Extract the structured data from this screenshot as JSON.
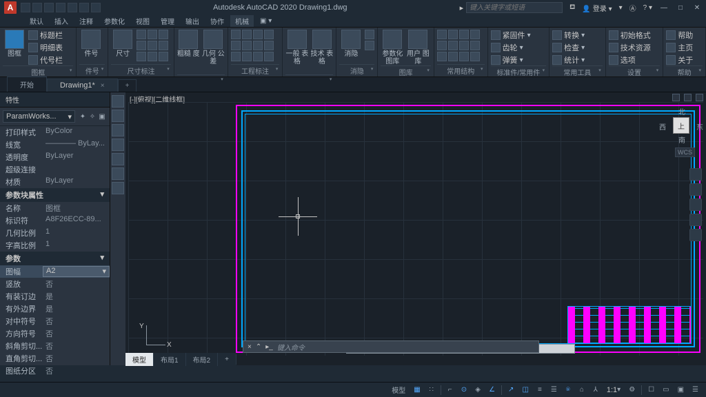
{
  "app_icon_letter": "A",
  "title": "Autodesk AutoCAD 2020   Drawing1.dwg",
  "search_placeholder": "键入关键字或短语",
  "login_label": "登录",
  "menus": [
    "默认",
    "插入",
    "注释",
    "参数化",
    "视图",
    "管理",
    "输出",
    "协作",
    "机械"
  ],
  "ribbon": {
    "panel1": {
      "label": "图框",
      "big": "图框",
      "items": [
        "标题栏",
        "明细表",
        "代号栏"
      ]
    },
    "panel2": {
      "label": "件号",
      "big": "件号"
    },
    "panel3": {
      "label": "尺寸标注",
      "big": "尺寸"
    },
    "panel4": {
      "label": "",
      "b1": "粗糙\n度",
      "b2": "几何\n公差"
    },
    "panel5": {
      "label": "工程标注"
    },
    "panel6": {
      "label": "",
      "b1": "一般\n表格",
      "b2": "技术\n表格"
    },
    "panel7": {
      "label": "消隐",
      "big": "消隐"
    },
    "panel8": {
      "label": "图库",
      "b1": "参数化\n图库",
      "b2": "用户\n图库"
    },
    "panel9": {
      "label": "常用结构"
    },
    "panel10": {
      "label": "标准件/常用件",
      "items": [
        "紧固件",
        "齿轮",
        "弹簧"
      ]
    },
    "panel11": {
      "label": "常用工具",
      "items": [
        "转换",
        "检查",
        "统计"
      ]
    },
    "panel12": {
      "label": "设置",
      "items": [
        "初始格式",
        "技术资源",
        "选项"
      ]
    },
    "panel13": {
      "label": "帮助",
      "items": [
        "帮助",
        "主页",
        "关于"
      ]
    }
  },
  "doc_tabs": {
    "tab1": "开始",
    "tab2": "Drawing1*",
    "add": "+"
  },
  "palette": {
    "title": "特性",
    "type": "ParamWorks...",
    "rows1": [
      {
        "k": "打印样式",
        "v": "ByColor"
      },
      {
        "k": "线宽",
        "v": "———— ByLay..."
      },
      {
        "k": "透明度",
        "v": "ByLayer"
      },
      {
        "k": "超级连接",
        "v": ""
      },
      {
        "k": "材质",
        "v": "ByLayer"
      }
    ],
    "section2": "参数块属性",
    "rows2": [
      {
        "k": "名称",
        "v": "图框"
      },
      {
        "k": "标识符",
        "v": "A8F26ECC-89..."
      },
      {
        "k": "几何比例",
        "v": "1"
      },
      {
        "k": "字高比例",
        "v": "1"
      }
    ],
    "section3": "参数",
    "rows3": [
      {
        "k": "图幅",
        "v": "A2"
      },
      {
        "k": "竖放",
        "v": "否"
      },
      {
        "k": "有装订边",
        "v": "是"
      },
      {
        "k": "有外边界",
        "v": "是"
      },
      {
        "k": "对中符号",
        "v": "否"
      },
      {
        "k": "方向符号",
        "v": "否"
      },
      {
        "k": "斜角剪切...",
        "v": "否"
      },
      {
        "k": "直角剪切...",
        "v": "否"
      },
      {
        "k": "图纸分区",
        "v": "否"
      }
    ]
  },
  "view_label": "[-][俯视][二维线框]",
  "viewcube": {
    "n": "北",
    "s": "南",
    "e": "东",
    "w": "西",
    "top": "上",
    "wcs": "WCS"
  },
  "ucs": {
    "x": "X",
    "y": "Y"
  },
  "cmd_placeholder": "键入命令",
  "btabs": {
    "t1": "模型",
    "t2": "布局1",
    "t3": "布局2",
    "add": "+"
  },
  "status": {
    "model": "模型",
    "scale": "1:1"
  }
}
